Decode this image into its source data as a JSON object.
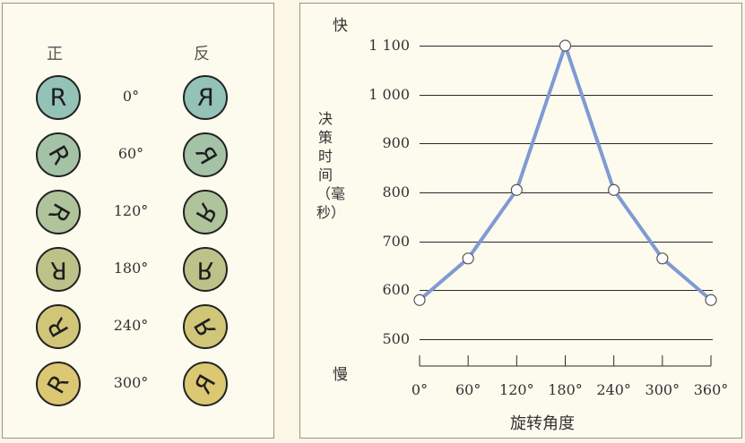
{
  "stimuli": {
    "normal_header": "正",
    "mirror_header": "反",
    "letter": "R",
    "rows": [
      {
        "rotation": 0,
        "label": "0°",
        "color": "#93c2b6"
      },
      {
        "rotation": 60,
        "label": "60°",
        "color": "#a3c2a6"
      },
      {
        "rotation": 120,
        "label": "120°",
        "color": "#b0c49b"
      },
      {
        "rotation": 180,
        "label": "180°",
        "color": "#bcc389"
      },
      {
        "rotation": 240,
        "label": "240°",
        "color": "#d1c578"
      },
      {
        "rotation": 300,
        "label": "300°",
        "color": "#dcc772"
      }
    ]
  },
  "chart_data": {
    "type": "line",
    "x": [
      0,
      60,
      120,
      180,
      240,
      300,
      360
    ],
    "x_tick_labels": [
      "0°",
      "60°",
      "120°",
      "180°",
      "240°",
      "300°",
      "360°"
    ],
    "series": [
      {
        "values": [
          580,
          665,
          805,
          1100,
          805,
          665,
          580
        ],
        "color": "#7f9ad3"
      }
    ],
    "y_ticks": [
      500,
      600,
      700,
      800,
      900,
      1000,
      1100
    ],
    "y_tick_labels": [
      "500",
      "600",
      "700",
      "800",
      "900",
      "1 000",
      "1 100"
    ],
    "ylim": [
      500,
      1100
    ],
    "xlim": [
      0,
      360
    ],
    "ylabel": "决策时间（毫秒）",
    "xlabel": "旋转角度",
    "y_top_label": "快",
    "y_bottom_label": "慢",
    "grid": "horizontal"
  }
}
